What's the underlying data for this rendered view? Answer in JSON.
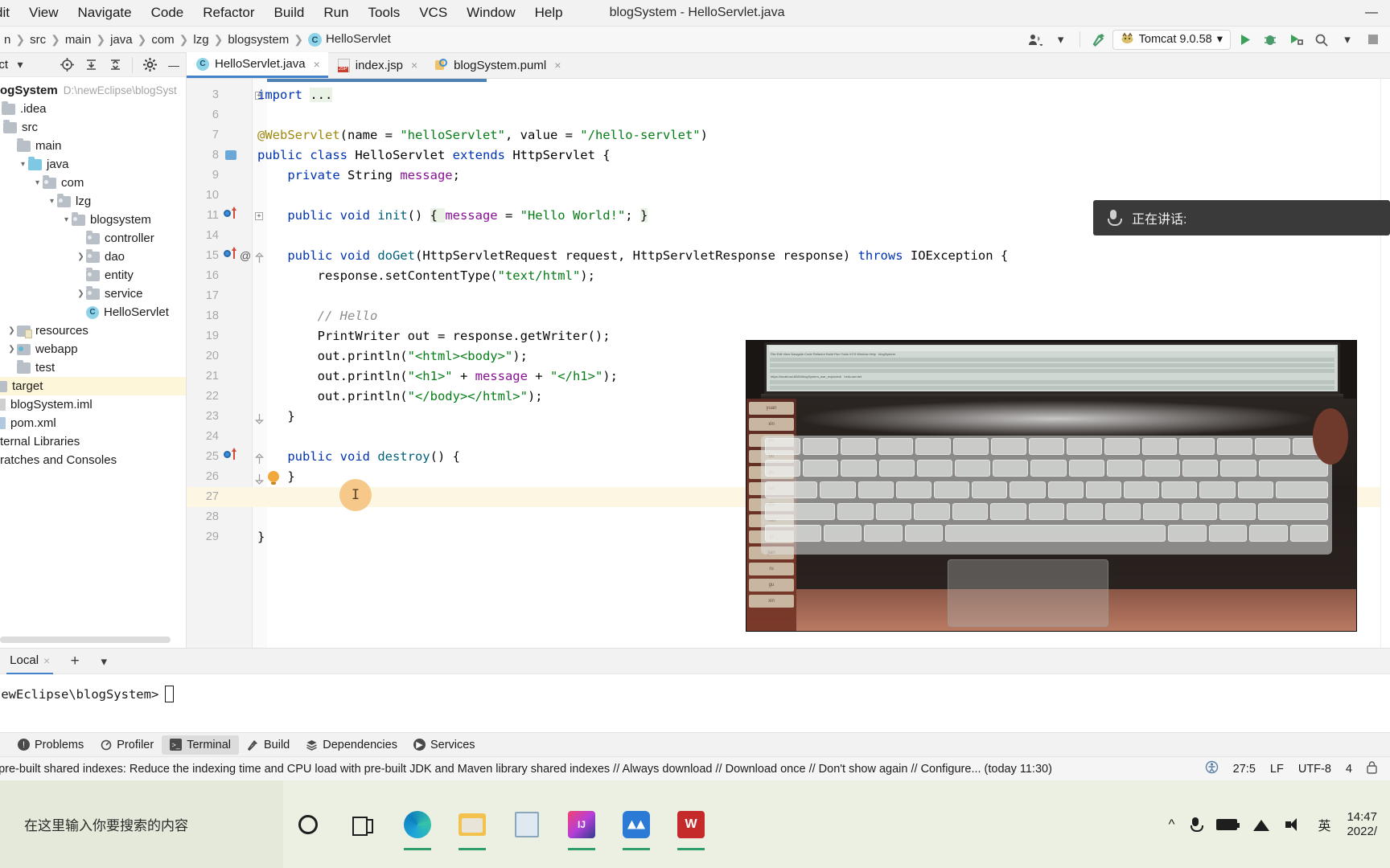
{
  "window": {
    "title": "blogSystem - HelloServlet.java",
    "minimize_label": "—",
    "menus": [
      {
        "label": "dit"
      },
      {
        "label": "View"
      },
      {
        "label": "Navigate"
      },
      {
        "label": "Code"
      },
      {
        "label": "Refactor"
      },
      {
        "label": "Build"
      },
      {
        "label": "Run"
      },
      {
        "label": "Tools"
      },
      {
        "label": "VCS"
      },
      {
        "label": "Window"
      },
      {
        "label": "Help"
      }
    ]
  },
  "navbar": {
    "breadcrumbs": [
      {
        "label": "n",
        "icon": ""
      },
      {
        "label": "src",
        "icon": ""
      },
      {
        "label": "main",
        "icon": ""
      },
      {
        "label": "java",
        "icon": ""
      },
      {
        "label": "com",
        "icon": ""
      },
      {
        "label": "lzg",
        "icon": ""
      },
      {
        "label": "blogsystem",
        "icon": ""
      },
      {
        "label": "HelloServlet",
        "icon": "class-icon"
      }
    ],
    "run_config": "Tomcat 9.0.58",
    "run_config_badge": "C",
    "icons": {
      "user": "user-icon",
      "hammer": "build-hammer-icon",
      "run": "run-icon",
      "debug": "debug-icon",
      "run_with_coverage": "coverage-icon",
      "search": "search-everywhere-icon",
      "stop": "stop-icon",
      "chevron": "chevron-down-icon"
    }
  },
  "project": {
    "panel_title": "ect",
    "header_icons": [
      "locate-icon",
      "expand-all-icon",
      "collapse-all-icon",
      "gear-icon",
      "hide-icon"
    ],
    "root_name": "ogSystem",
    "root_path": "D:\\newEclipse\\blogSyst",
    "tree": [
      {
        "label": ".idea",
        "indent": 0,
        "arrow": "",
        "icon": "folder-gray",
        "sel": false
      },
      {
        "label": "src",
        "indent": 0,
        "arrow": "",
        "icon": "folder-gray",
        "sel": false
      },
      {
        "label": "main",
        "indent": 1,
        "arrow": "",
        "icon": "folder-gray",
        "sel": false
      },
      {
        "label": "java",
        "indent": 1,
        "arrow": "v",
        "icon": "folder-blue",
        "sel": false
      },
      {
        "label": "com",
        "indent": 2,
        "arrow": "v",
        "icon": "folder-pkg",
        "sel": false
      },
      {
        "label": "lzg",
        "indent": 3,
        "arrow": "v",
        "icon": "folder-pkg",
        "sel": false
      },
      {
        "label": "blogsystem",
        "indent": 4,
        "arrow": "v",
        "icon": "folder-pkg",
        "sel": false
      },
      {
        "label": "controller",
        "indent": 5,
        "arrow": "",
        "icon": "folder-pkg",
        "sel": false
      },
      {
        "label": "dao",
        "indent": 5,
        "arrow": ">",
        "icon": "folder-pkg",
        "sel": false
      },
      {
        "label": "entity",
        "indent": 5,
        "arrow": "",
        "icon": "folder-pkg",
        "sel": false
      },
      {
        "label": "service",
        "indent": 5,
        "arrow": ">",
        "icon": "folder-pkg",
        "sel": false
      },
      {
        "label": "HelloServlet",
        "indent": 5,
        "arrow": "",
        "icon": "class",
        "sel": false
      },
      {
        "label": "resources",
        "indent": 1,
        "arrow": ">",
        "icon": "folder-res",
        "sel": false
      },
      {
        "label": "webapp",
        "indent": 1,
        "arrow": ">",
        "icon": "folder-web",
        "sel": false
      },
      {
        "label": "test",
        "indent": 1,
        "arrow": "",
        "icon": "folder-gray",
        "sel": false
      },
      {
        "label": "target",
        "indent": 0,
        "arrow": "",
        "icon": "folder-gray",
        "sel": true
      },
      {
        "label": "blogSystem.iml",
        "indent": 0,
        "arrow": "",
        "icon": "file-iml",
        "sel": false
      },
      {
        "label": "pom.xml",
        "indent": 0,
        "arrow": "",
        "icon": "file-xml",
        "sel": false
      },
      {
        "label": "ternal Libraries",
        "indent": 0,
        "arrow": "",
        "icon": "lib",
        "sel": false
      },
      {
        "label": "ratches and Consoles",
        "indent": 0,
        "arrow": "",
        "icon": "lib",
        "sel": false
      }
    ]
  },
  "editor": {
    "tabs": [
      {
        "label": "HelloServlet.java",
        "icon": "java-class-icon",
        "active": true,
        "close": "×"
      },
      {
        "label": "index.jsp",
        "icon": "jsp-file-icon",
        "active": false,
        "close": "×"
      },
      {
        "label": "blogSystem.puml",
        "icon": "puml-file-icon",
        "active": false,
        "close": "×"
      }
    ],
    "lines": [
      {
        "num": "3",
        "marks": [],
        "fold": "plus",
        "tokens": [
          {
            "t": "import ",
            "c": "kw"
          },
          {
            "t": "...",
            "c": "hl plain"
          }
        ]
      },
      {
        "num": "6",
        "marks": [],
        "fold": "",
        "tokens": []
      },
      {
        "num": "7",
        "marks": [],
        "fold": "",
        "tokens": [
          {
            "t": "@WebServlet",
            "c": "anno"
          },
          {
            "t": "(name = ",
            "c": "plain"
          },
          {
            "t": "\"helloServlet\"",
            "c": "str"
          },
          {
            "t": ", value = ",
            "c": "plain"
          },
          {
            "t": "\"/hello-servlet\"",
            "c": "str"
          },
          {
            "t": ")",
            "c": "plain"
          }
        ]
      },
      {
        "num": "8",
        "marks": [
          "override"
        ],
        "fold": "",
        "tokens": [
          {
            "t": "public class ",
            "c": "kw"
          },
          {
            "t": "HelloServlet ",
            "c": "typ"
          },
          {
            "t": "extends ",
            "c": "kw"
          },
          {
            "t": "HttpServlet {",
            "c": "typ"
          }
        ]
      },
      {
        "num": "9",
        "marks": [],
        "fold": "",
        "tokens": [
          {
            "t": "    private ",
            "c": "kw"
          },
          {
            "t": "String ",
            "c": "typ"
          },
          {
            "t": "message",
            "c": "fld"
          },
          {
            "t": ";",
            "c": "plain"
          }
        ]
      },
      {
        "num": "10",
        "marks": [],
        "fold": "",
        "tokens": []
      },
      {
        "num": "11",
        "marks": [
          "run",
          "arrow"
        ],
        "fold": "plus",
        "tokens": [
          {
            "t": "    public void ",
            "c": "kw"
          },
          {
            "t": "init",
            "c": "mth"
          },
          {
            "t": "() ",
            "c": "plain"
          },
          {
            "t": "{ ",
            "c": "hl plain"
          },
          {
            "t": "message",
            "c": "fld"
          },
          {
            "t": " = ",
            "c": "plain"
          },
          {
            "t": "\"Hello World!\"",
            "c": "str"
          },
          {
            "t": "; ",
            "c": "plain"
          },
          {
            "t": "}",
            "c": "hl plain"
          }
        ]
      },
      {
        "num": "14",
        "marks": [],
        "fold": "",
        "tokens": []
      },
      {
        "num": "15",
        "marks": [
          "run",
          "arrow",
          "at"
        ],
        "fold": "capdn",
        "tokens": [
          {
            "t": "    public void ",
            "c": "kw"
          },
          {
            "t": "doGet",
            "c": "mth"
          },
          {
            "t": "(HttpServletRequest request, HttpServletResponse response) ",
            "c": "plain"
          },
          {
            "t": "throws ",
            "c": "kw"
          },
          {
            "t": "IOException {",
            "c": "plain"
          }
        ]
      },
      {
        "num": "16",
        "marks": [],
        "fold": "",
        "tokens": [
          {
            "t": "        response.setContentType(",
            "c": "plain"
          },
          {
            "t": "\"text/html\"",
            "c": "str"
          },
          {
            "t": ");",
            "c": "plain"
          }
        ]
      },
      {
        "num": "17",
        "marks": [],
        "fold": "",
        "tokens": []
      },
      {
        "num": "18",
        "marks": [],
        "fold": "",
        "tokens": [
          {
            "t": "        // Hello",
            "c": "cmt"
          }
        ]
      },
      {
        "num": "19",
        "marks": [],
        "fold": "",
        "tokens": [
          {
            "t": "        PrintWriter out = response.getWriter();",
            "c": "plain"
          }
        ]
      },
      {
        "num": "20",
        "marks": [],
        "fold": "",
        "tokens": [
          {
            "t": "        out.println(",
            "c": "plain"
          },
          {
            "t": "\"<html><body>\"",
            "c": "str"
          },
          {
            "t": ");",
            "c": "plain"
          }
        ]
      },
      {
        "num": "21",
        "marks": [],
        "fold": "",
        "tokens": [
          {
            "t": "        out.println(",
            "c": "plain"
          },
          {
            "t": "\"<h1>\"",
            "c": "str"
          },
          {
            "t": " + ",
            "c": "plain"
          },
          {
            "t": "message",
            "c": "fld"
          },
          {
            "t": " + ",
            "c": "plain"
          },
          {
            "t": "\"</h1>\"",
            "c": "str"
          },
          {
            "t": ");",
            "c": "plain"
          }
        ]
      },
      {
        "num": "22",
        "marks": [],
        "fold": "",
        "tokens": [
          {
            "t": "        out.println(",
            "c": "plain"
          },
          {
            "t": "\"</body></html>\"",
            "c": "str"
          },
          {
            "t": ");",
            "c": "plain"
          }
        ]
      },
      {
        "num": "23",
        "marks": [],
        "fold": "capup",
        "tokens": [
          {
            "t": "    }",
            "c": "plain"
          }
        ]
      },
      {
        "num": "24",
        "marks": [],
        "fold": "",
        "tokens": []
      },
      {
        "num": "25",
        "marks": [
          "run",
          "arrow"
        ],
        "fold": "capdn",
        "tokens": [
          {
            "t": "    public void ",
            "c": "kw"
          },
          {
            "t": "destroy",
            "c": "mth"
          },
          {
            "t": "() {",
            "c": "plain"
          }
        ]
      },
      {
        "num": "26",
        "marks": [
          "bulb"
        ],
        "fold": "capup",
        "tokens": [
          {
            "t": "    }",
            "c": "plain"
          }
        ]
      },
      {
        "num": "27",
        "marks": [
          "caret"
        ],
        "fold": "",
        "tokens": [],
        "cursor": true
      },
      {
        "num": "28",
        "marks": [],
        "fold": "",
        "tokens": []
      },
      {
        "num": "29",
        "marks": [],
        "fold": "",
        "tokens": [
          {
            "t": "}",
            "c": "plain"
          }
        ]
      }
    ]
  },
  "toast": {
    "text": "正在讲话:",
    "icon": "microphone-icon"
  },
  "terminal": {
    "panel_label": ":",
    "tab_label": "Local",
    "tab_close": "×",
    "add_label": "+",
    "dropdown_label": "∨",
    "prompt": "newEclipse\\blogSystem>"
  },
  "toolwindows": [
    {
      "label": "Problems",
      "icon": "problems-icon",
      "active": false
    },
    {
      "label": "Profiler",
      "icon": "profiler-icon",
      "active": false
    },
    {
      "label": "Terminal",
      "icon": "terminal-icon",
      "active": true
    },
    {
      "label": "Build",
      "icon": "build-hammer-icon",
      "active": false
    },
    {
      "label": "Dependencies",
      "icon": "dependencies-icon",
      "active": false
    },
    {
      "label": "Services",
      "icon": "services-icon",
      "active": false
    }
  ],
  "statusbar": {
    "message": "d pre-built shared indexes: Reduce the indexing time and CPU load with pre-built JDK and Maven library shared indexes // Always download // Download once // Don't show again // Configure... (today 11:30)",
    "accessibility_icon": "accessibility-icon",
    "caret_position": "27:5",
    "line_separator": "LF",
    "encoding": "UTF-8",
    "indent": "4"
  },
  "taskbar": {
    "search_placeholder": "在这里输入你要搜索的内容",
    "apps": [
      {
        "name": "cortana-icon",
        "running": false
      },
      {
        "name": "task-view-icon",
        "running": false
      },
      {
        "name": "edge-icon",
        "running": true
      },
      {
        "name": "file-explorer-icon",
        "running": true
      },
      {
        "name": "notes-icon",
        "running": false
      },
      {
        "name": "intellij-idea-icon",
        "running": true
      },
      {
        "name": "blue-app-icon",
        "running": true
      },
      {
        "name": "wps-icon",
        "running": true
      }
    ],
    "tray": {
      "chevron": "chevron-up-icon",
      "mic": "microphone-icon",
      "network": "network-icon",
      "volume": "volume-icon",
      "ime": "英",
      "time": "14:47",
      "date": "2022/"
    }
  },
  "colors": {
    "accent": "#4283c9",
    "keyword": "#0033b3",
    "string": "#067d17",
    "annotation": "#9e880d",
    "field": "#871094",
    "method": "#00627a",
    "comment": "#8c8c8c",
    "selection": "#fdf6d9",
    "toast_bg": "#3a3a3a",
    "taskbar_bg": "#ecf0e3"
  }
}
